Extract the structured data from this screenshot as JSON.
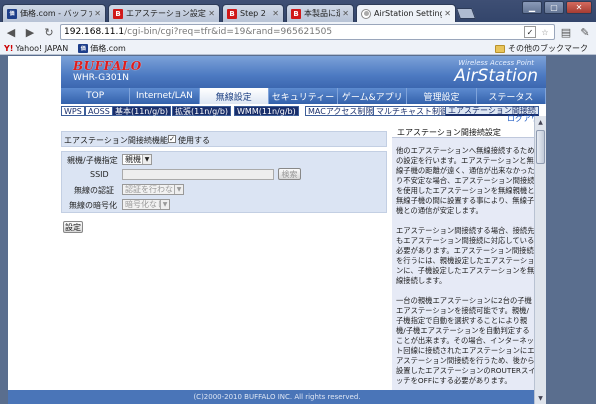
{
  "browser": {
    "tabs": [
      {
        "title": "価格.com - バッファロー",
        "icon": "kakaku-favicon"
      },
      {
        "title": "エアステーション設定ガイ",
        "icon": "buffalo-favicon"
      },
      {
        "title": "Step 2",
        "icon": "buffalo-favicon"
      },
      {
        "title": "本製品に遭切",
        "icon": "buffalo-favicon"
      },
      {
        "title": "AirStation Settings",
        "icon": "airstation-favicon"
      }
    ],
    "url_host": "192.168.11.1",
    "url_path": "/cgi-bin/cgi?req=tfr&id=19&rand=965621505",
    "bookmarks": [
      {
        "label": "Yahoo! JAPAN",
        "icon": "yahoo-icon"
      },
      {
        "label": "価格.com",
        "icon": "kakaku-favicon"
      }
    ],
    "other_bookmarks": "その他のブックマーク"
  },
  "router": {
    "logo": "BUFFALO",
    "model": "WHR-G301N",
    "tagline": "Wireless Access Point",
    "product": "AirStation",
    "main_nav": [
      "TOP",
      "Internet/LAN",
      "無線設定",
      "セキュリティー",
      "ゲーム&アプリ",
      "管理設定",
      "ステータス"
    ],
    "main_nav_active": "無線設定",
    "sub_nav": [
      "WPS",
      "AOSS",
      "基本(11n/g/b)",
      "拡張(11n/g/b)",
      "WMM(11n/g/b)",
      "MACアクセス制限",
      "マルチキャスト制御",
      "エアステーション間接続"
    ],
    "logout": "ログアウト"
  },
  "form": {
    "feature_label": "エアステーション間接続機能",
    "use_label": "使用する",
    "use_checked": true,
    "mode_label": "親機/子機指定",
    "mode_value": "親機",
    "ssid_label": "SSID",
    "ssid_value": "",
    "search_button": "検索",
    "auth_label": "無線の認証",
    "auth_value": "認証を行わない",
    "encryption_label": "無線の暗号化",
    "encryption_value": "暗号化なし",
    "submit_button": "設定"
  },
  "help": {
    "title": "エアステーション間接続設定",
    "paragraphs": [
      "他のエアステーションへ無線接続するための設定を行います。エアステーションと無線子機の距離が遠く、通信が出来なかったり不安定な場合、エアステーション間接続を使用したエアステーションを無線親機と無線子機の間に設置する事により、無線子機との通信が安定します。",
      "エアステーション間接続する場合、接続先もエアステーション間接続に対応している必要があります。エアステーション間接続を行うには、親機設定したエアステーションに、子機設定したエアステーションを無線接続します。",
      "一台の親機エアステーションに2台の子機エアステーションを接続可能です。親機/子機指定で自動を選択することにより親機/子機エアステーションを自動判定することが出来ます。その場合、インターネット回線に接続されたエアステーションにエアステーション間接続を行うため、後から設置したエアステーションのROUTERスイッチをOFFにする必要があります。"
    ]
  },
  "footer": "(C)2000-2010 BUFFALO INC. All rights reserved."
}
